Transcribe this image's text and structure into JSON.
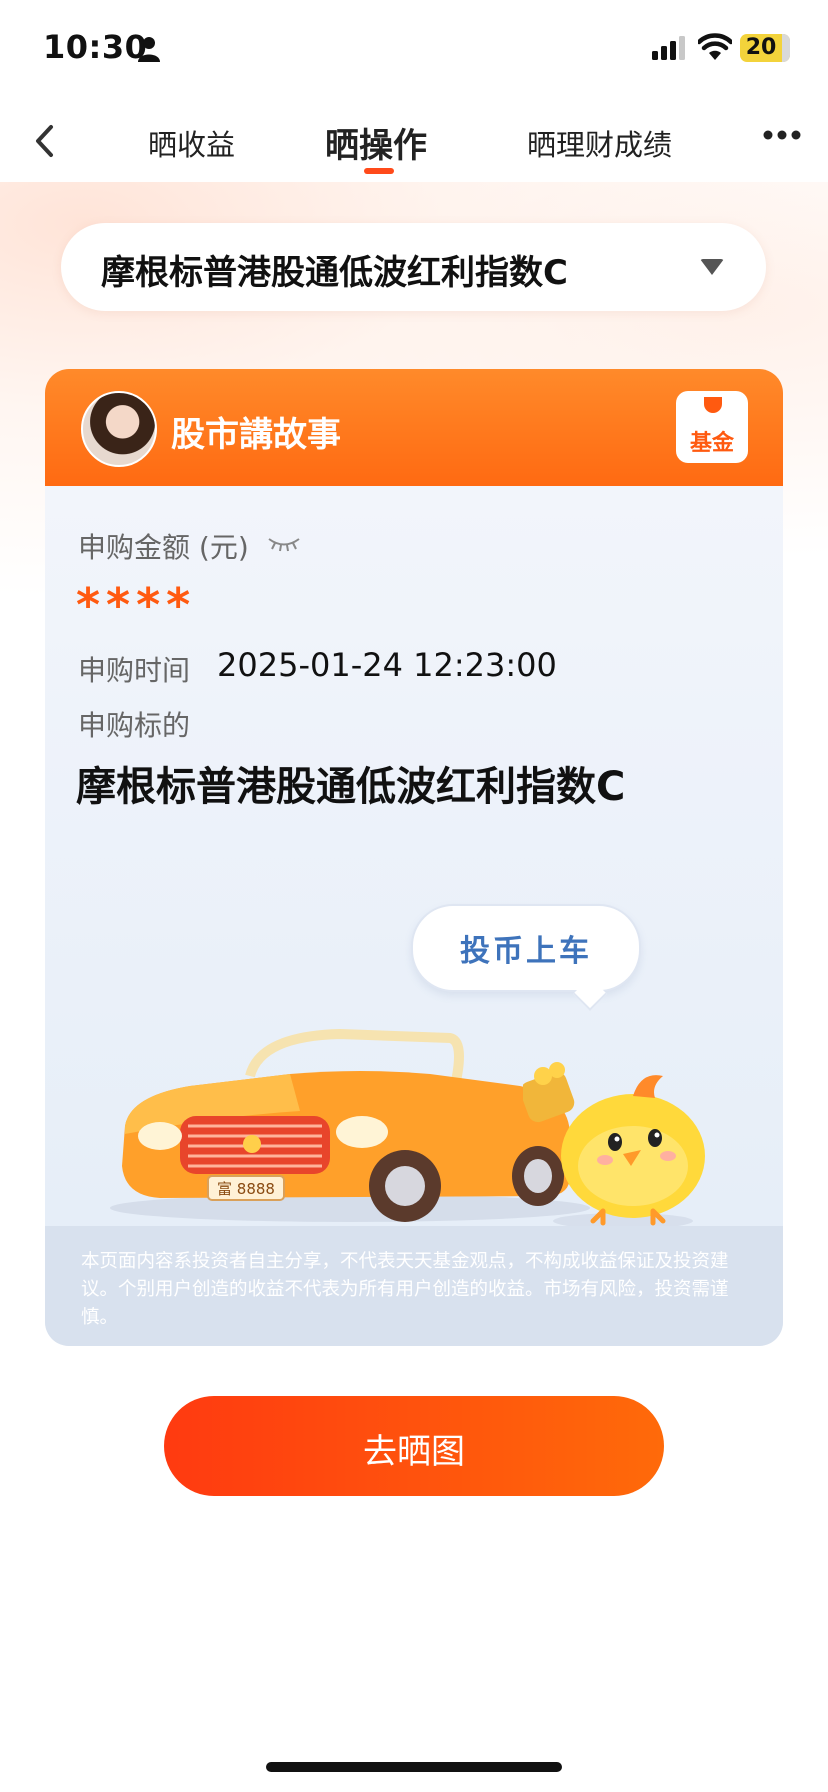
{
  "status_bar": {
    "time": "10:30",
    "battery": "20",
    "battery_color": "#f3d33b"
  },
  "nav": {
    "tabs": [
      {
        "label": "晒收益"
      },
      {
        "label": "晒操作"
      },
      {
        "label": "晒理财成绩"
      }
    ],
    "active_tab_index": 1,
    "accent_color": "#ff4a1a"
  },
  "fund_selector": {
    "selected": "摩根标普港股通低波红利指数C"
  },
  "card": {
    "author_name": "股市講故事",
    "fund_logo_text": "基金",
    "amount_label": "申购金额 (元)",
    "amount_value": "****",
    "time_label": "申购时间",
    "time_value": "2025-01-24 12:23:00",
    "target_label": "申购标的",
    "target_value": "摩根标普港股通低波红利指数C",
    "bubble_text": "投币上车",
    "plate_text": "富 8888",
    "disclaimer": "本页面内容系投资者自主分享，不代表天天基金观点，不构成收益保证及投资建议。个别用户创造的收益不代表为所有用户创造的收益。市场有风险，投资需谨慎。"
  },
  "cta": {
    "label": "去晒图"
  },
  "icons": {
    "back": "chevron-left-icon",
    "more": "more-icon",
    "eye": "eye-closed-icon",
    "caret": "caret-down-icon"
  }
}
